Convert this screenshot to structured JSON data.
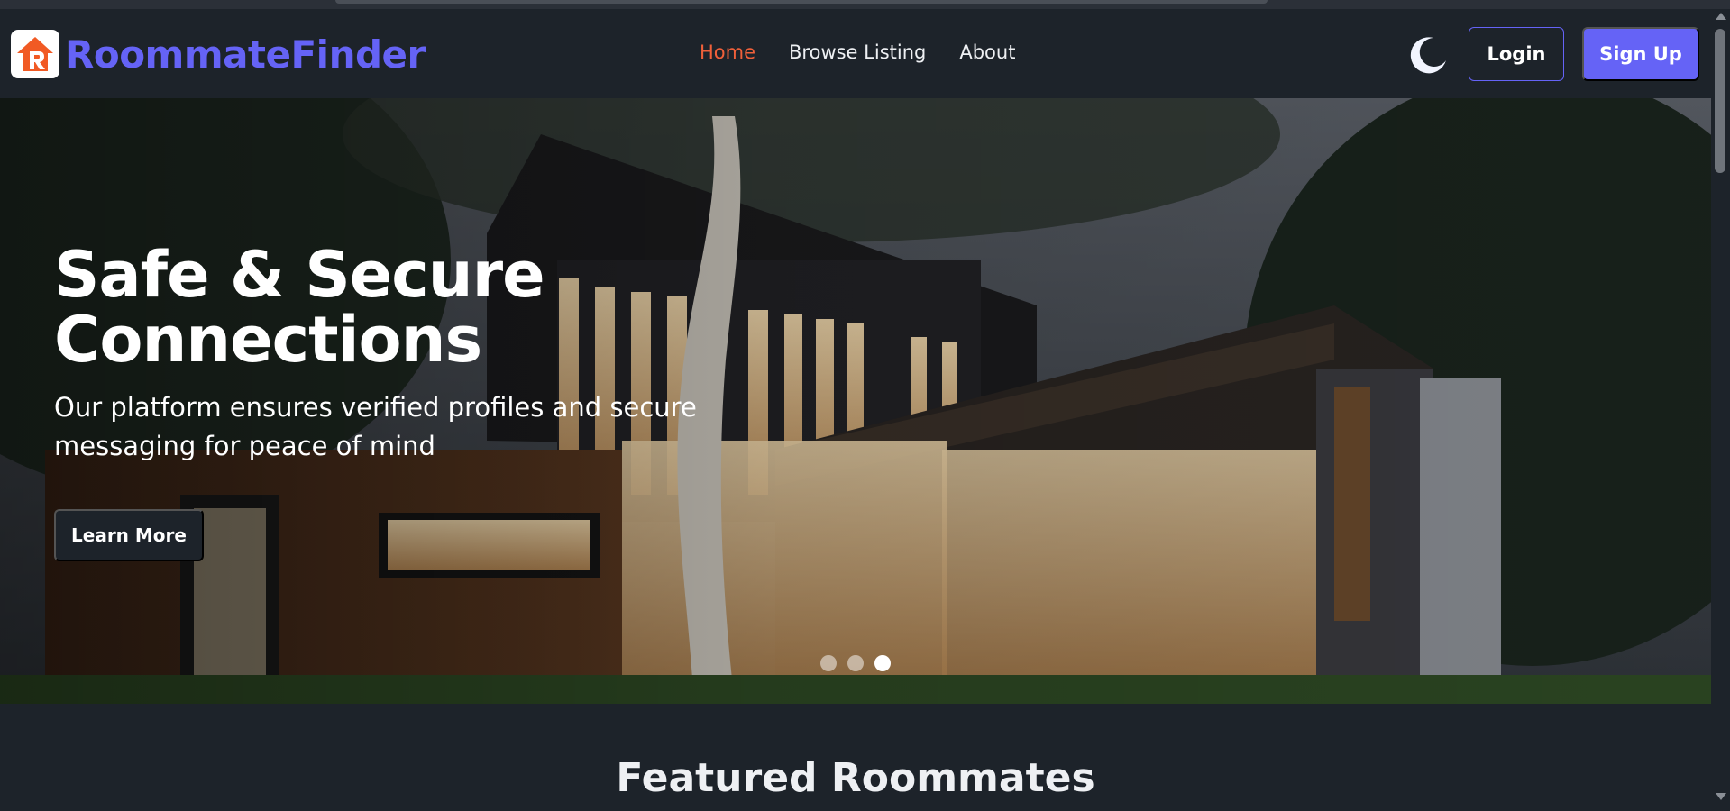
{
  "brand": {
    "name": "RoommateFinder",
    "logo_icon": "house-r-logo-icon",
    "brand_color": "#6563f6",
    "logo_color": "#f15a24"
  },
  "nav": {
    "links": [
      {
        "label": "Home",
        "active": true
      },
      {
        "label": "Browse Listing",
        "active": false
      },
      {
        "label": "About",
        "active": false
      }
    ],
    "active_color": "#f0603a",
    "theme_toggle_icon": "moon-icon",
    "login_label": "Login",
    "signup_label": "Sign Up"
  },
  "hero": {
    "title": "Safe & Secure Connections",
    "subtitle": "Our platform ensures verified profiles and secure messaging for peace of mind",
    "cta_label": "Learn More",
    "slides": {
      "count": 3,
      "active_index": 2
    }
  },
  "featured": {
    "title": "Featured Roommates"
  },
  "colors": {
    "background": "#1d232a",
    "accent": "#6563f6"
  }
}
